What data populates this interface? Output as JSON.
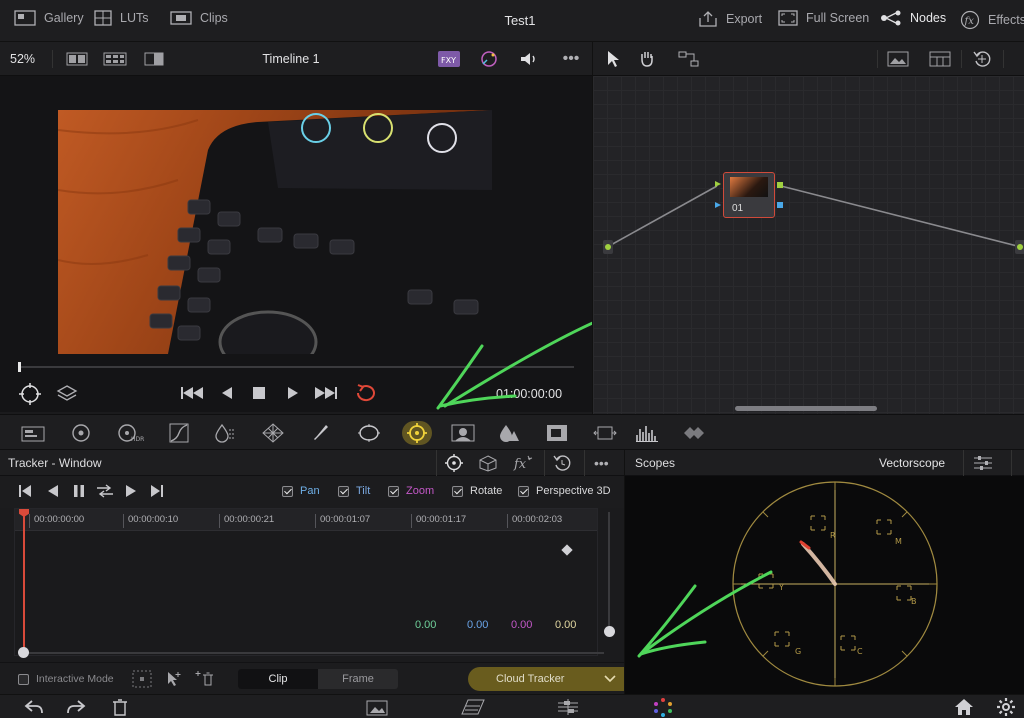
{
  "top": {
    "gallery": "Gallery",
    "luts": "LUTs",
    "clips": "Clips",
    "project_title": "Test1",
    "export": "Export",
    "full_screen": "Full Screen",
    "nodes": "Nodes",
    "effects": "Effects"
  },
  "viewer": {
    "zoom": "52%",
    "timeline_name": "Timeline 1",
    "timecode": "01:00:00:00"
  },
  "node": {
    "label": "01"
  },
  "tracker": {
    "title": "Tracker - Window",
    "checks": [
      {
        "label": "Pan",
        "color": "#6fb0e8"
      },
      {
        "label": "Tilt",
        "color": "#7aa8e0"
      },
      {
        "label": "Zoom",
        "color": "#c458c8"
      },
      {
        "label": "Rotate",
        "color": "#d8d8da"
      },
      {
        "label": "Perspective 3D",
        "color": "#d8d8da"
      }
    ],
    "ruler": [
      "00:00:00:00",
      "00:00:00:10",
      "00:00:00:21",
      "00:00:01:07",
      "00:00:01:17",
      "00:00:02:03"
    ],
    "values": [
      {
        "text": "0.00",
        "color": "#6fcf9a"
      },
      {
        "text": "0.00",
        "color": "#6aa4e8"
      },
      {
        "text": "0.00",
        "color": "#c458c8"
      },
      {
        "text": "0.00",
        "color": "#e0d6a0"
      }
    ],
    "interactive_mode": "Interactive Mode",
    "seg_clip": "Clip",
    "seg_frame": "Frame",
    "cloud_tracker": "Cloud Tracker"
  },
  "scopes": {
    "title": "Scopes",
    "mode": "Vectorscope",
    "targets": [
      "R",
      "M",
      "B",
      "C",
      "G",
      "Y"
    ]
  },
  "colors": {
    "accent_red": "#d84a3a",
    "highlight_yellow": "#dcbe28",
    "annotation_green": "#4fd65a"
  }
}
